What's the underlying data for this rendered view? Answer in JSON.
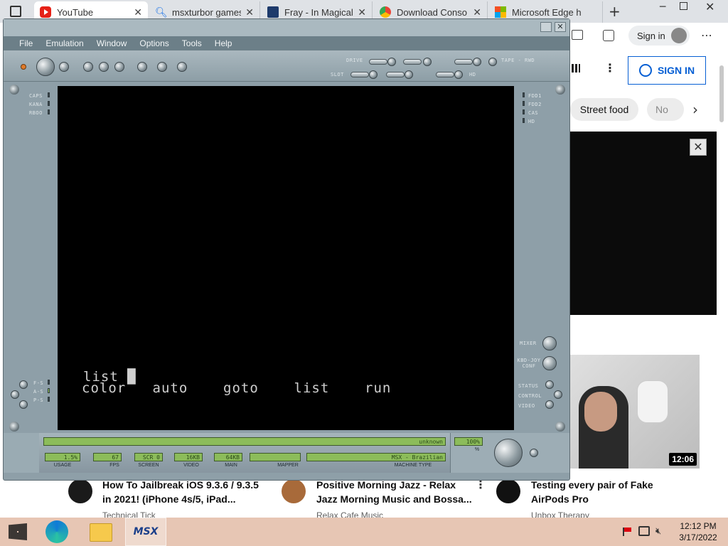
{
  "tabs": [
    {
      "title": "YouTube",
      "icon": "youtube-icon"
    },
    {
      "title": "msxturbor games",
      "icon": "search-icon"
    },
    {
      "title": "Fray - In Magical",
      "icon": "document-icon"
    },
    {
      "title": "Download Conso",
      "icon": "chrome-icon"
    },
    {
      "title": "Microsoft Edge h",
      "icon": "microsoft-icon"
    }
  ],
  "browser": {
    "signin_label": "Sign in",
    "yt_signin_label": "SIGN IN",
    "chips": [
      "Street food",
      "No"
    ],
    "video_duration": "12:06",
    "videos": [
      {
        "title_line1": "How To Jailbreak iOS 9.3.6 / 9.3.5",
        "title_line2": "in 2021! (iPhone 4s/5, iPad...",
        "channel": "Technical Tick"
      },
      {
        "title_line1": "Positive Morning Jazz - Relax",
        "title_line2": "Jazz Morning Music and Bossa...",
        "channel": "Relax Cafe Music"
      },
      {
        "title_line1": "Testing every pair of Fake",
        "title_line2": "AirPods Pro",
        "channel": "Unbox Therapy"
      }
    ]
  },
  "emulator": {
    "menus": [
      "File",
      "Emulation",
      "Window",
      "Options",
      "Tools",
      "Help"
    ],
    "toolbar_labels": {
      "drive": "DRIVE",
      "slot": "SLOT",
      "tape": "TAPE - RWD",
      "hd": "HD"
    },
    "left_leds": [
      "CAPS",
      "KANA",
      "RBOO"
    ],
    "right_leds": [
      "FDD1",
      "FDD2",
      "CAS",
      "HD"
    ],
    "bottom_left_leds": [
      "F-S",
      "A-S",
      "P-S"
    ],
    "right_controls": [
      "MIXER",
      "KBD-JOY CONF",
      "STATUS",
      "CONTROL",
      "VIDEO"
    ],
    "screen_line1": "list █",
    "screen_line2": "color   auto    goto    list    run",
    "status": {
      "top_field": "unknown",
      "usage_value": "1.5%",
      "fps_value": "67",
      "screen_value": "SCR 0",
      "video_value": "16KB",
      "main_value": "64KB",
      "mapper_value": "",
      "machine_value": "MSX - Brazilian",
      "volume_value": "100%",
      "percent_sign": "%",
      "labels": [
        "USAGE",
        "FPS",
        "SCREEN",
        "VIDEO",
        "MAIN",
        "MAPPER",
        "MACHINE TYPE"
      ]
    }
  },
  "taskbar": {
    "time": "12:12 PM",
    "date": "3/17/2022",
    "msx_label": "MSX"
  }
}
